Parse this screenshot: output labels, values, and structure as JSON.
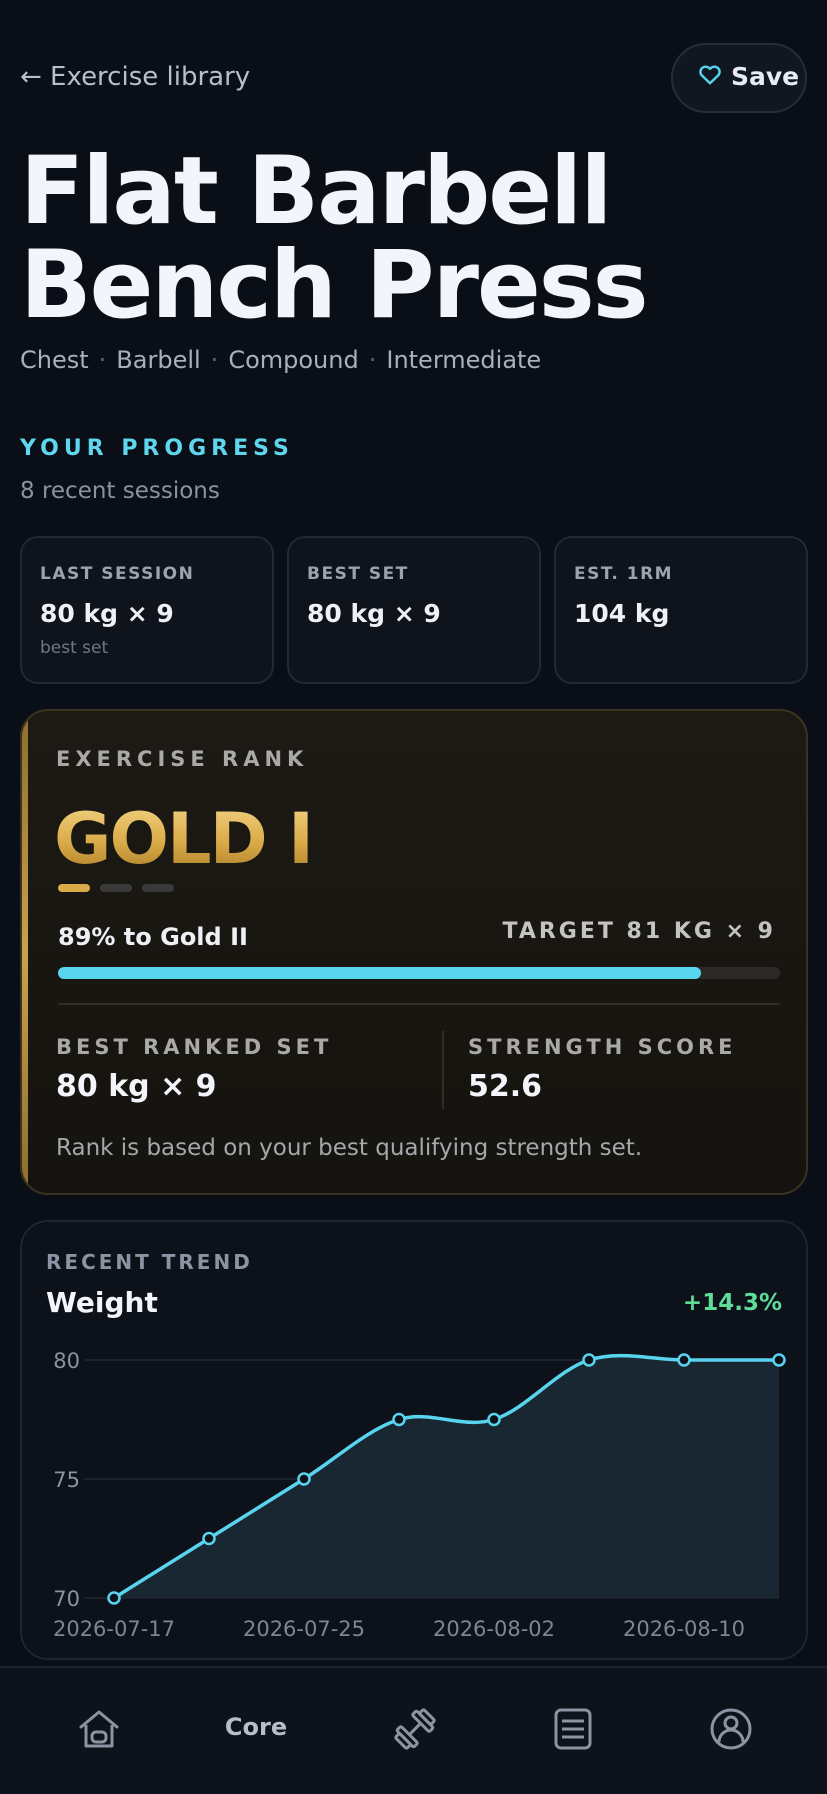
{
  "topbar": {
    "back_label": "← Exercise library",
    "save_label": "Save"
  },
  "exercise": {
    "title": "Flat Barbell Bench Press",
    "tags": [
      "Chest",
      "Barbell",
      "Compound",
      "Intermediate"
    ]
  },
  "progress": {
    "heading": "YOUR PROGRESS",
    "subtitle": "8 recent sessions",
    "stats": [
      {
        "label": "LAST SESSION",
        "value": "80 kg × 9",
        "note": "best set"
      },
      {
        "label": "BEST SET",
        "value": "80 kg × 9",
        "note": ""
      },
      {
        "label": "EST. 1RM",
        "value": "104 kg",
        "note": ""
      }
    ]
  },
  "rank": {
    "heading": "EXERCISE RANK",
    "tier": "GOLD I",
    "sub_tier_progress": {
      "active": 1,
      "total": 3
    },
    "progress_text": "89% to Gold II",
    "progress_fraction": 0.89,
    "target": "TARGET 81 KG × 9",
    "best_ranked_set_label": "BEST RANKED SET",
    "best_ranked_set_value": "80 kg × 9",
    "strength_score_label": "STRENGTH SCORE",
    "strength_score_value": "52.6",
    "note": "Rank is based on your best qualifying strength set.",
    "colors": {
      "gold": "#d9aa47",
      "progress": "#59d4ef"
    }
  },
  "trend": {
    "heading": "RECENT TREND",
    "title": "Weight",
    "change": "+14.3%"
  },
  "chart_data": {
    "type": "area",
    "x": [
      "2026-07-17",
      "2026-07-21",
      "2026-07-25",
      "2026-07-29",
      "2026-08-02",
      "2026-08-06",
      "2026-08-10",
      "2026-08-14"
    ],
    "series": [
      {
        "values": [
          70,
          72.5,
          75,
          77.5,
          77.5,
          80,
          80,
          80
        ]
      }
    ],
    "x_tick_labels": [
      "2026-07-17",
      "2026-07-25",
      "2026-08-02",
      "2026-08-10"
    ],
    "y_ticks": [
      70,
      75,
      80
    ],
    "ylim": [
      70,
      80
    ],
    "grid": true,
    "color": "#59d4ef"
  },
  "nav": {
    "items": [
      {
        "icon": "home-icon"
      },
      {
        "label": "Core"
      },
      {
        "icon": "dumbbell-icon"
      },
      {
        "icon": "log-icon"
      },
      {
        "icon": "profile-icon"
      }
    ]
  }
}
